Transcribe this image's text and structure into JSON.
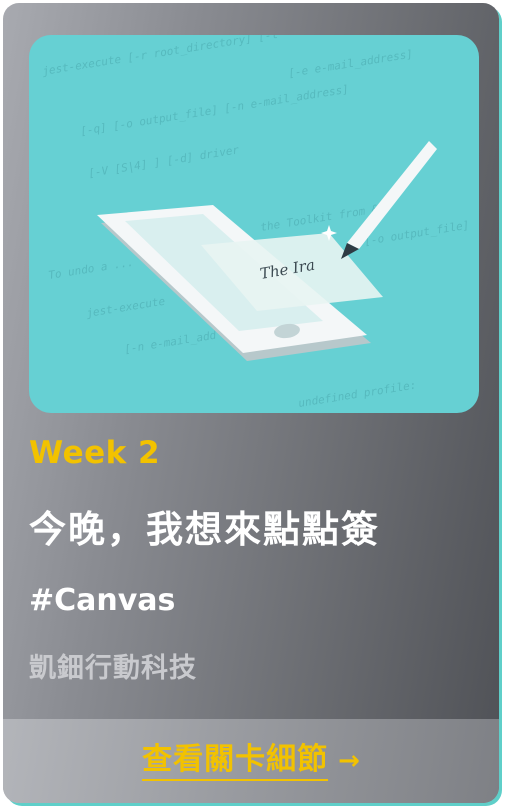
{
  "card": {
    "week": "Week 2",
    "title": "今晚，我想來點點簽",
    "tag": "#Canvas",
    "company": "凱鈿行動科技",
    "cta_label": "查看關卡細節"
  },
  "illustration": {
    "code_lines": [
      "jest-execute [-r root_directory] [-l",
      "[-e e-mail_address]",
      "[-q] [-o output_file] [-n e-mail_address]",
      "[-V [S|4] ] [-d] driver",
      "the Toolkit from &",
      "To undo a ...",
      "[-o output_file]",
      "jest-execute",
      "[-n e-mail_add",
      "undefined profile:"
    ],
    "signature": "The Ira"
  },
  "colors": {
    "accent": "#f2c200",
    "hero_bg": "#66d0d3",
    "text_primary": "#ffffff",
    "text_muted": "#c9cace"
  },
  "icons": {
    "cta_arrow": "arrow-right-icon",
    "illustration": "tablet-stylus-illustration"
  }
}
